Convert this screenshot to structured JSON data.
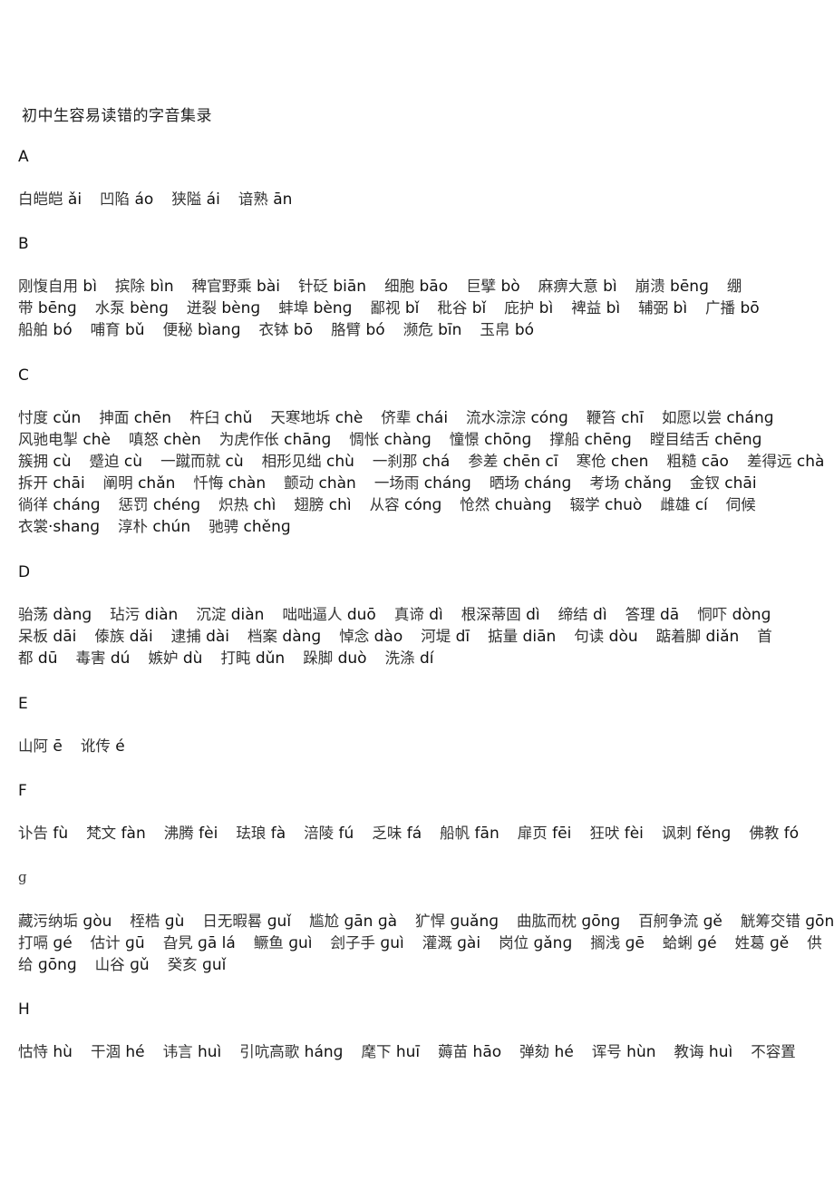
{
  "title": "初中生容易读错的字音集录",
  "sections": [
    {
      "letter": "A",
      "lines": [
        [
          [
            "白皑皑",
            "ǎi"
          ],
          [
            "凹陷",
            "áo"
          ],
          [
            "狭隘",
            "ái"
          ],
          [
            "谙熟",
            "ān"
          ]
        ]
      ]
    },
    {
      "letter": "B",
      "lines": [
        [
          [
            "刚愎自用",
            "bì"
          ],
          [
            "摈除",
            "bìn"
          ],
          [
            "稗官野乘",
            "bài"
          ],
          [
            "针砭",
            "biān"
          ],
          [
            "细胞",
            "bāo"
          ],
          [
            "巨擘",
            "bò"
          ],
          [
            "麻痹大意",
            "bì"
          ],
          [
            "崩溃",
            "bēnɡ"
          ],
          [
            "绷",
            ""
          ]
        ],
        [
          [
            "带",
            "bēnɡ"
          ],
          [
            "水泵",
            "bènɡ"
          ],
          [
            "迸裂",
            "bènɡ"
          ],
          [
            "蚌埠",
            "bènɡ"
          ],
          [
            "鄙视",
            "bǐ"
          ],
          [
            "秕谷",
            "bǐ"
          ],
          [
            "庇护",
            "bì"
          ],
          [
            "裨益",
            "bì"
          ],
          [
            "辅弼",
            "bì"
          ],
          [
            "广播",
            "bō"
          ]
        ],
        [
          [
            "船舶",
            "bó"
          ],
          [
            "哺育",
            "bǔ"
          ],
          [
            "便秘",
            "bìanɡ"
          ],
          [
            "衣钵",
            "bō"
          ],
          [
            "胳臂",
            "bó"
          ],
          [
            "濒危",
            "bīn"
          ],
          [
            "玉帛",
            "bó"
          ]
        ]
      ]
    },
    {
      "letter": "C",
      "lines": [
        [
          [
            "忖度",
            "cǔn"
          ],
          [
            "抻面",
            "chēn"
          ],
          [
            "杵臼",
            "chǔ"
          ],
          [
            "天寒地坼",
            "chè"
          ],
          [
            "侪辈",
            "chái"
          ],
          [
            "流水淙淙",
            "cónɡ"
          ],
          [
            "鞭笞",
            "chī"
          ],
          [
            "如愿以尝",
            "chánɡ"
          ]
        ],
        [
          [
            "风驰电掣",
            "chè"
          ],
          [
            "嗔怒",
            "chèn"
          ],
          [
            "为虎作伥",
            "chānɡ"
          ],
          [
            "惆怅",
            "chànɡ"
          ],
          [
            "憧憬",
            "chōnɡ"
          ],
          [
            "撑船",
            "chēnɡ"
          ],
          [
            "瞠目结舌",
            "chēnɡ"
          ]
        ],
        [
          [
            "簇拥",
            "cù"
          ],
          [
            "蹙迫",
            "cù"
          ],
          [
            "一蹴而就",
            "cù"
          ],
          [
            "相形见绌",
            "chù"
          ],
          [
            "一刹那",
            "chá"
          ],
          [
            "参差",
            "chēn cī"
          ],
          [
            "寒伧",
            "chen"
          ],
          [
            "粗糙",
            "cāo"
          ],
          [
            "差得远",
            "chà"
          ]
        ],
        [
          [
            "拆开",
            "chāi"
          ],
          [
            "阐明",
            "chǎn"
          ],
          [
            "忏悔",
            "chàn"
          ],
          [
            "颤动",
            "chàn"
          ],
          [
            "一场雨",
            "chánɡ"
          ],
          [
            "晒场",
            "chánɡ"
          ],
          [
            "考场",
            "chǎnɡ"
          ],
          [
            "金钗",
            "chāi"
          ]
        ],
        [
          [
            "徜徉",
            "chánɡ"
          ],
          [
            "惩罚",
            "chénɡ"
          ],
          [
            "炽热",
            "chì"
          ],
          [
            "翅膀",
            "chì"
          ],
          [
            "从容",
            "cónɡ"
          ],
          [
            "怆然",
            "chuànɡ"
          ],
          [
            "辍学",
            "chuò"
          ],
          [
            "雌雄",
            "cí"
          ],
          [
            "伺候",
            ""
          ]
        ],
        [
          [
            "衣裳",
            "·shanɡ"
          ],
          [
            "淳朴",
            "chún"
          ],
          [
            "驰骋",
            "chěnɡ"
          ]
        ]
      ]
    },
    {
      "letter": "D",
      "lines": [
        [
          [
            "骀荡",
            "dànɡ"
          ],
          [
            "玷污",
            "diàn"
          ],
          [
            "沉淀",
            "diàn"
          ],
          [
            "咄咄逼人",
            "duō"
          ],
          [
            "真谛",
            "dì"
          ],
          [
            "根深蒂固",
            "dì"
          ],
          [
            "缔结",
            "dì"
          ],
          [
            "答理",
            "dā"
          ],
          [
            "恫吓",
            "dònɡ"
          ]
        ],
        [
          [
            "呆板",
            "dāi"
          ],
          [
            "傣族",
            "dǎi"
          ],
          [
            "逮捕",
            "dài"
          ],
          [
            "档案",
            "dànɡ"
          ],
          [
            "悼念",
            "dào"
          ],
          [
            "河堤",
            "dī"
          ],
          [
            "掂量",
            "diān"
          ],
          [
            "句读",
            "dòu"
          ],
          [
            "踮着脚",
            "diǎn"
          ],
          [
            "首",
            ""
          ]
        ],
        [
          [
            "都",
            "dū"
          ],
          [
            "毒害",
            "dú"
          ],
          [
            "嫉妒",
            "dù"
          ],
          [
            "打盹",
            "dǔn"
          ],
          [
            "跺脚",
            "duò"
          ],
          [
            "洗涤",
            "dí"
          ]
        ]
      ]
    },
    {
      "letter": "E",
      "lines": [
        [
          [
            "山阿",
            "ē"
          ],
          [
            "讹传",
            "é"
          ]
        ]
      ]
    },
    {
      "letter": "F",
      "lines": [
        [
          [
            "讣告",
            "fù"
          ],
          [
            "梵文",
            "fàn"
          ],
          [
            "沸腾",
            "fèi"
          ],
          [
            "珐琅",
            "fà"
          ],
          [
            "涪陵",
            "fú"
          ],
          [
            "乏味",
            "fá"
          ],
          [
            "船帆",
            "fān"
          ],
          [
            "扉页",
            "fēi"
          ],
          [
            "狂吠",
            "fèi"
          ],
          [
            "讽刺",
            "fěnɡ"
          ],
          [
            "佛教",
            "fó"
          ]
        ]
      ]
    },
    {
      "letter": "ɡ",
      "stray": true,
      "lines": [
        [
          [
            "藏污纳垢",
            "ɡòu"
          ],
          [
            "桎梏",
            "ɡù"
          ],
          [
            "日无暇晷",
            "ɡuǐ"
          ],
          [
            "尴尬",
            "ɡān ɡà"
          ],
          [
            "犷悍",
            "ɡuǎnɡ"
          ],
          [
            "曲肱而枕",
            "ɡōnɡ"
          ],
          [
            "百舸争流",
            "ɡě"
          ],
          [
            "觥筹交错",
            "ɡōnɡ"
          ]
        ],
        [
          [
            "打嗝",
            "ɡé"
          ],
          [
            "估计",
            "ɡū"
          ],
          [
            "旮旯",
            "ɡā lá"
          ],
          [
            "鳜鱼",
            "ɡuì"
          ],
          [
            "刽子手",
            "ɡuì"
          ],
          [
            "灌溉",
            "ɡài"
          ],
          [
            "岗位",
            "ɡǎnɡ"
          ],
          [
            "搁浅",
            "ɡē"
          ],
          [
            "蛤蜊",
            "ɡé"
          ],
          [
            "姓葛",
            "ɡě"
          ],
          [
            "供",
            ""
          ]
        ],
        [
          [
            "给",
            "ɡōnɡ"
          ],
          [
            "山谷",
            "ɡǔ"
          ],
          [
            "癸亥",
            "ɡuǐ"
          ]
        ]
      ]
    },
    {
      "letter": "H",
      "lines": [
        [
          [
            "怙恃",
            "hù"
          ],
          [
            "干涸",
            "hé"
          ],
          [
            "讳言",
            "huì"
          ],
          [
            "引吭高歌",
            "hánɡ"
          ],
          [
            "麾下",
            "huī"
          ],
          [
            "薅苗",
            "hāo"
          ],
          [
            "弹劾",
            "hé"
          ],
          [
            "诨号",
            "hùn"
          ],
          [
            "教诲",
            "huì"
          ],
          [
            "不容置",
            ""
          ]
        ]
      ]
    }
  ]
}
